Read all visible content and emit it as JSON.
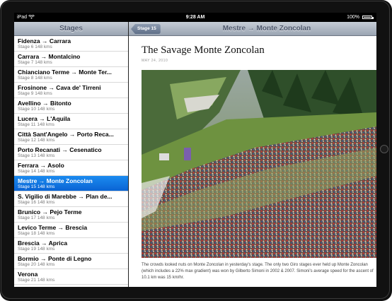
{
  "status_bar": {
    "carrier": "iPad",
    "time": "9:28 AM",
    "battery": "100%"
  },
  "master": {
    "title": "Stages",
    "items": [
      {
        "title": "Fidenza → Carrara",
        "subtitle": "Stage 6 148 kms",
        "selected": false
      },
      {
        "title": "Carrara → Montalcino",
        "subtitle": "Stage 7 148 kms",
        "selected": false
      },
      {
        "title": "Chianciano Terme → Monte Ter...",
        "subtitle": "Stage 8 148 kms",
        "selected": false
      },
      {
        "title": "Frosinone → Cava de' Tirreni",
        "subtitle": "Stage 9 148 kms",
        "selected": false
      },
      {
        "title": "Avellino → Bitonto",
        "subtitle": "Stage 10 148 kms",
        "selected": false
      },
      {
        "title": "Lucera → L'Aquila",
        "subtitle": "Stage 11 148 kms",
        "selected": false
      },
      {
        "title": "Città Sant'Angelo → Porto Reca...",
        "subtitle": "Stage 12 148 kms",
        "selected": false
      },
      {
        "title": "Porto Recanati → Cesenatico",
        "subtitle": "Stage 13 148 kms",
        "selected": false
      },
      {
        "title": "Ferrara → Asolo",
        "subtitle": "Stage 14 148 kms",
        "selected": false
      },
      {
        "title": "Mestre → Monte Zoncolan",
        "subtitle": "Stage 15 148 kms",
        "selected": true
      },
      {
        "title": "S. Vigilio di Marebbe → Plan de...",
        "subtitle": "Stage 16 148 kms",
        "selected": false
      },
      {
        "title": "Brunico → Pejo Terme",
        "subtitle": "Stage 17 148 kms",
        "selected": false
      },
      {
        "title": "Levico Terme → Brescia",
        "subtitle": "Stage 18 148 kms",
        "selected": false
      },
      {
        "title": "Brescia → Aprica",
        "subtitle": "Stage 19 148 kms",
        "selected": false
      },
      {
        "title": "Bormio → Ponte di Legno",
        "subtitle": "Stage 20 148 kms",
        "selected": false
      },
      {
        "title": "Verona",
        "subtitle": "Stage 21 148 kms",
        "selected": false
      }
    ]
  },
  "detail": {
    "back_label": "Stage 15",
    "title": "Mestre → Monte Zoncolan",
    "article_title": "The Savage Monte Zoncolan",
    "date": "MAY 24, 2010",
    "caption": "The crowds looked nuts on Monte Zoncolan in yesterday's stage. The only two Giro stages ever held up Monte Zoncolan (which includes a 22% max gradient) was won by Gilberto Simoni in 2002 & 2007. Simoni's average speed for the ascent of 10.1 km was 15 km/hr."
  },
  "colors": {
    "selection": "#0a64d4",
    "navbar": "#9aa4b2"
  }
}
